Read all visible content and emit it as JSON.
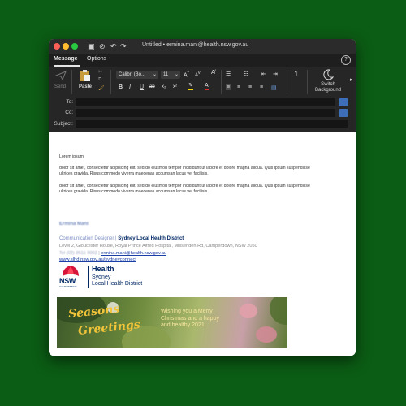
{
  "window": {
    "title": "Untitled • ermina.mani@health.nsw.gov.au",
    "tabs": [
      {
        "label": "Message"
      },
      {
        "label": "Options"
      }
    ]
  },
  "ribbon": {
    "send_label": "Send",
    "paste_label": "Paste",
    "font_name": "Calibri (Bo...",
    "font_size": "11",
    "bold": "B",
    "italic": "I",
    "underline": "U",
    "strikethrough": "ab",
    "subscript": "x₂",
    "superscript": "x²",
    "switch_background_label": "Switch\nBackground"
  },
  "fields": {
    "to_label": "To:",
    "cc_label": "Cc:",
    "subject_label": "Subject:"
  },
  "body": {
    "greeting": "Lorem ipsum",
    "paragraph1": "dolor sit amet, consectetur adipiscing elit, sed do eiusmod tempor incididunt ut labore et dolore magna aliqua. Quis ipsum suspendisse ultrices gravida. Risus commodo viverra maecenas accumsan lacus vel facilisis.",
    "paragraph2": "dolor sit amet, consectetur adipiscing elit, sed do eiusmod tempor incididunt ut labore et dolore magna aliqua. Quis ipsum suspendisse ultrices gravida. Risus commodo viverra maecenas accumsan lacus vel facilisis."
  },
  "signature": {
    "name": "Ermina Mani",
    "role": "Communication Designer",
    "separator": "|",
    "organisation": "Sydney Local Health District",
    "address": "Level 2, Gloucester House, Royal Prince Alfred Hospital, Missenden Rd, Camperdown, NSW 2050",
    "phone": "Tel (02) 9515 9002",
    "email": "ermina.mani@health.nsw.gov.au",
    "website": "www.slhd.nsw.gov.au/sydneyconnect",
    "logo_nsw": "NSW",
    "logo_gov": "GOVERNMENT",
    "logo_health": "Health",
    "logo_sydney": "Sydney",
    "logo_district": "Local Health District"
  },
  "banner": {
    "title_line1": "Seasons",
    "title_line2": "Greetings",
    "message": "Wishing you a Merry Christmas and a happy and healthy 2021."
  },
  "colors": {
    "background": "#0b5c14",
    "toolbar": "#262626",
    "link": "#1a3fa6",
    "org_blue": "#002664",
    "nsw_red": "#d7153a"
  }
}
